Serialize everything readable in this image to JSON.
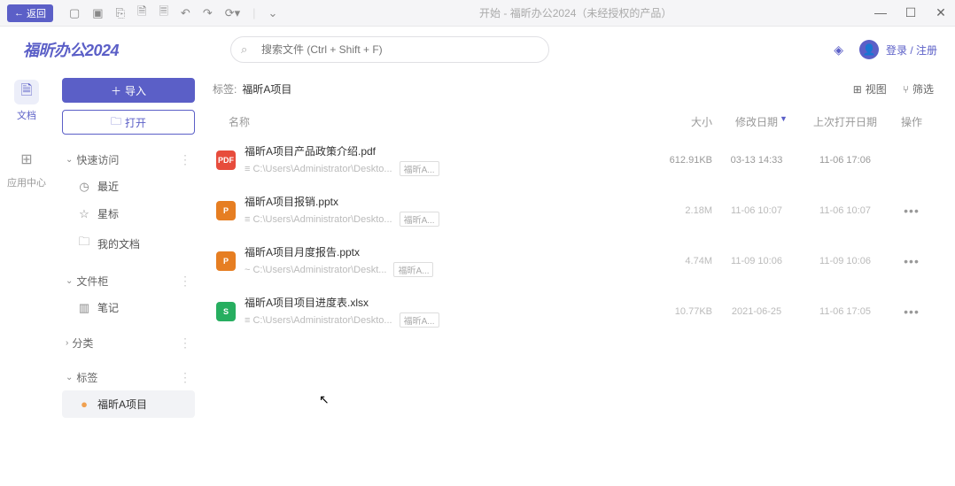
{
  "titlebar": {
    "back": "返回",
    "title": "开始 - 福昕办公2024（未经授权的产品）"
  },
  "logo": "福昕办公2024",
  "search": {
    "placeholder": "搜索文件 (Ctrl + Shift + F)"
  },
  "user": {
    "login": "登录 / 注册"
  },
  "rail": {
    "docs": "文档",
    "apps": "应用中心"
  },
  "sidebar": {
    "import": "导入",
    "open": "打开",
    "quick": "快速访问",
    "recent": "最近",
    "star": "星标",
    "mydocs": "我的文档",
    "filebox": "文件柜",
    "journal": "笔记",
    "category": "分类",
    "tags": "标签",
    "tag_project": "福昕A项目"
  },
  "content": {
    "crumb_label": "标签:",
    "crumb_value": "福昕A项目",
    "view": "视图",
    "filter": "筛选",
    "head_name": "名称",
    "head_size": "大小",
    "head_mod": "修改日期",
    "head_open": "上次打开日期",
    "head_act": "操作"
  },
  "files": [
    {
      "name": "福昕A项目产品政策介绍.pdf",
      "path": "≡ C:\\Users\\Administrator\\Deskto...",
      "tag": "福昕A...",
      "size": "612.91KB",
      "mod": "03-13 14:33",
      "open": "11-06 17:06",
      "type": "pdf",
      "active": true
    },
    {
      "name": "福昕A项目报销.pptx",
      "path": "≡ C:\\Users\\Administrator\\Deskto...",
      "tag": "福昕A...",
      "size": "2.18M",
      "mod": "11-06 10:07",
      "open": "11-06 10:07",
      "type": "ppt",
      "active": false
    },
    {
      "name": "福昕A项目月度报告.pptx",
      "path": "~ C:\\Users\\Administrator\\Deskt...",
      "tag": "福昕A...",
      "size": "4.74M",
      "mod": "11-09 10:06",
      "open": "11-09 10:06",
      "type": "ppt",
      "active": false
    },
    {
      "name": "福昕A项目项目进度表.xlsx",
      "path": "≡ C:\\Users\\Administrator\\Deskto...",
      "tag": "福昕A...",
      "size": "10.77KB",
      "mod": "2021-06-25",
      "open": "11-06 17:05",
      "type": "xls",
      "active": false
    }
  ]
}
